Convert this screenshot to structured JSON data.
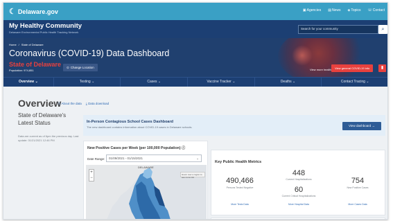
{
  "topbar": {
    "brand": "Delaware.gov",
    "links": [
      "Agencies",
      "News",
      "Topics",
      "Contact"
    ]
  },
  "community": {
    "title": "My Healthy Community",
    "subtitle": "Delaware Environmental Public Health Tracking Network",
    "search_placeholder": "Search for your community"
  },
  "banner": {
    "breadcrumb": [
      "Home",
      "State of Delaware"
    ],
    "title": "Coronavirus (COVID-19) Data Dashboard",
    "state": "State of Delaware",
    "population": "Population: 974,851",
    "change_location": "Change Location",
    "view_health_data": "View more health data",
    "view_general": "View general COVID-19 info"
  },
  "nav": [
    "Overview",
    "Testing",
    "Cases",
    "Vaccine Tracker",
    "Deaths",
    "Contact Tracing"
  ],
  "overview": {
    "heading": "Overview",
    "about_link": "About the data",
    "download_link": "Data download"
  },
  "status": {
    "title": "State of Delaware's Latest Status",
    "note": "Data are current as of 6pm the previous day. Last update: 01/21/2021 12:46 PM"
  },
  "school": {
    "title": "In-Person Contagious School Cases Dashboard",
    "description": "The new dashboard contains information about COVID-19 cases in Delaware schools.",
    "button": "View dashboard"
  },
  "map": {
    "title": "New Positive Cases per Week (per 100,000 Population)",
    "date_label": "Date Range:",
    "date_value": "01/09/2021 - 01/15/2021",
    "map_label": "DELAWARE",
    "tooltip": "Hover over a region to see more info"
  },
  "metrics": {
    "title": "Key Public Health Metrics",
    "tested_value": "490,466",
    "tested_label": "Persons Tested Negative",
    "tested_link": "More Tests Data",
    "hosp_value": "448",
    "hosp_label": "Current Hospitalizations",
    "critical_value": "60",
    "critical_label": "Current Critical Hospitalizations",
    "hosp_link": "More Hospital Data",
    "cases_value": "754",
    "cases_label": "New Positive Cases",
    "cases_link": "More Cases Data"
  },
  "colors": {
    "topbar": "#3aa0c5",
    "navy": "#1c3f73",
    "accent_red": "#e8413e",
    "link": "#2d69b3"
  }
}
